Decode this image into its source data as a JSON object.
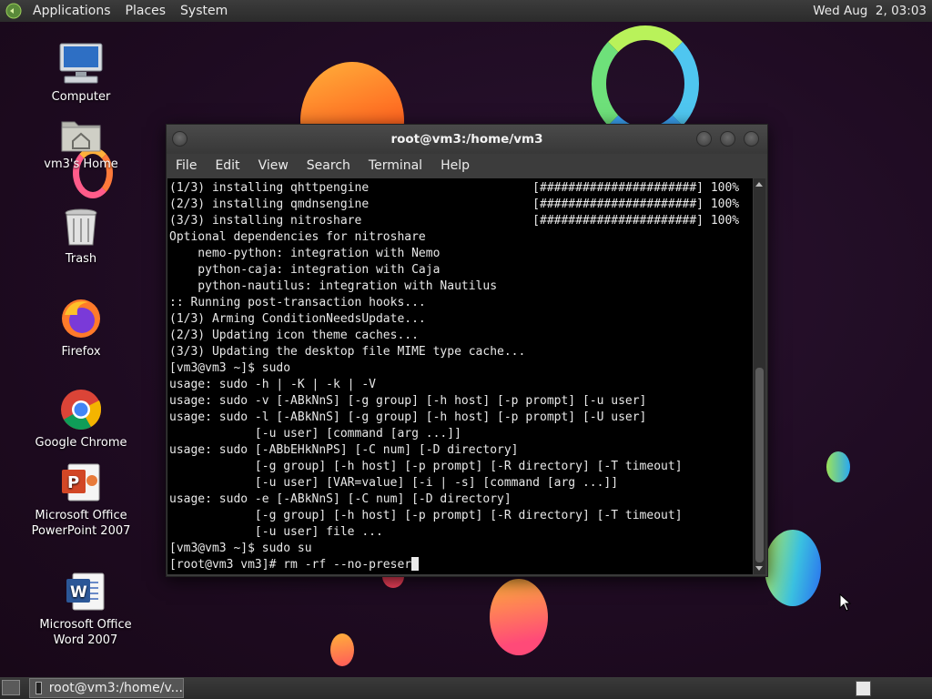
{
  "top_panel": {
    "menus": [
      "Applications",
      "Places",
      "System"
    ],
    "clock": "Wed Aug  2, 03:03"
  },
  "desktop_icons": [
    {
      "label": "Computer",
      "icon": "computer-icon"
    },
    {
      "label": "vm3's Home",
      "icon": "home-folder-icon"
    },
    {
      "label": "Trash",
      "icon": "trash-icon"
    },
    {
      "label": "Firefox",
      "icon": "firefox-icon"
    },
    {
      "label": "Google Chrome",
      "icon": "chrome-icon"
    },
    {
      "label": "Microsoft Office PowerPoint 2007",
      "icon": "powerpoint-icon"
    },
    {
      "label": "Microsoft Office Word 2007",
      "icon": "word-icon"
    }
  ],
  "terminal": {
    "title": "root@vm3:/home/vm3",
    "menu": [
      "File",
      "Edit",
      "View",
      "Search",
      "Terminal",
      "Help"
    ],
    "lines": [
      "(1/3) installing qhttpengine                       [######################] 100%",
      "(2/3) installing qmdnsengine                       [######################] 100%",
      "(3/3) installing nitroshare                        [######################] 100%",
      "Optional dependencies for nitroshare",
      "    nemo-python: integration with Nemo",
      "    python-caja: integration with Caja",
      "    python-nautilus: integration with Nautilus",
      ":: Running post-transaction hooks...",
      "(1/3) Arming ConditionNeedsUpdate...",
      "(2/3) Updating icon theme caches...",
      "(3/3) Updating the desktop file MIME type cache...",
      "[vm3@vm3 ~]$ sudo",
      "usage: sudo -h | -K | -k | -V",
      "usage: sudo -v [-ABkNnS] [-g group] [-h host] [-p prompt] [-u user]",
      "usage: sudo -l [-ABkNnS] [-g group] [-h host] [-p prompt] [-U user]",
      "            [-u user] [command [arg ...]]",
      "usage: sudo [-ABbEHkNnPS] [-C num] [-D directory]",
      "            [-g group] [-h host] [-p prompt] [-R directory] [-T timeout]",
      "            [-u user] [VAR=value] [-i | -s] [command [arg ...]]",
      "usage: sudo -e [-ABkNnS] [-C num] [-D directory]",
      "            [-g group] [-h host] [-p prompt] [-R directory] [-T timeout]",
      "            [-u user] file ...",
      "[vm3@vm3 ~]$ sudo su"
    ],
    "prompt_line": "[root@vm3 vm3]# rm -rf --no-preser"
  },
  "taskbar": {
    "window_label": "root@vm3:/home/v..."
  }
}
